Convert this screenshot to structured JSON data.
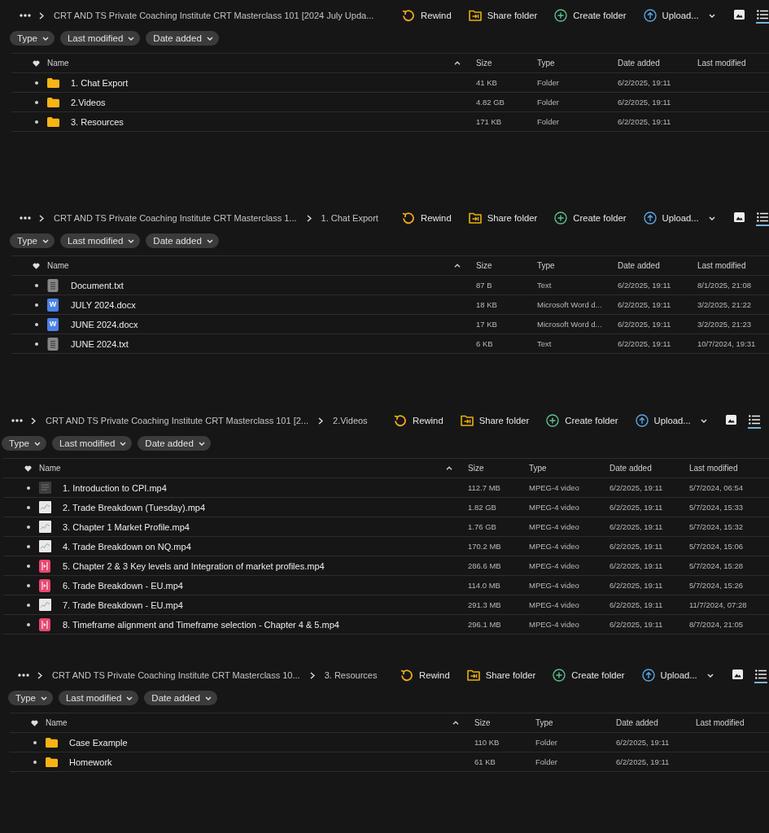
{
  "panels": [
    {
      "breadcrumb": [
        "CRT AND TS Private Coaching Institute CRT Masterclass 101 [2024 July Upda..."
      ],
      "actions": [
        {
          "kind": "rewind",
          "label": "Rewind"
        },
        {
          "kind": "share",
          "label": "Share folder"
        },
        {
          "kind": "create",
          "label": "Create folder"
        },
        {
          "kind": "upload",
          "label": "Upload..."
        }
      ],
      "views": [
        {
          "kind": "gallery",
          "selected": false
        },
        {
          "kind": "list",
          "selected": true
        }
      ],
      "filters": [
        "Type",
        "Last modified",
        "Date added"
      ],
      "columns": [
        {
          "label": "Name",
          "sorted": true
        },
        {
          "label": "Size",
          "sorted": false
        },
        {
          "label": "Type",
          "sorted": false
        },
        {
          "label": "Date added",
          "sorted": false
        },
        {
          "label": "Last modified",
          "sorted": false
        }
      ],
      "rows": [
        {
          "kind": "folder",
          "name": "1. Chat Export",
          "size": "41 KB",
          "type": "Folder",
          "date_added": "6/2/2025, 19:11"
        },
        {
          "kind": "folder",
          "name": "2.Videos",
          "size": "4.82 GB",
          "type": "Folder",
          "date_added": "6/2/2025, 19:11"
        },
        {
          "kind": "folder",
          "name": "3. Resources",
          "size": "171 KB",
          "type": "Folder",
          "date_added": "6/2/2025, 19:11"
        }
      ]
    },
    {
      "breadcrumb": [
        "CRT AND TS Private Coaching Institute CRT Masterclass 1...",
        "1. Chat Export"
      ],
      "actions": [
        {
          "kind": "rewind",
          "label": "Rewind"
        },
        {
          "kind": "share",
          "label": "Share folder"
        },
        {
          "kind": "create",
          "label": "Create folder"
        },
        {
          "kind": "upload",
          "label": "Upload..."
        }
      ],
      "views": [
        {
          "kind": "gallery",
          "selected": false
        },
        {
          "kind": "list",
          "selected": true
        }
      ],
      "filters": [
        "Type",
        "Last modified",
        "Date added"
      ],
      "columns": [
        {
          "label": "Name",
          "sorted": true
        },
        {
          "label": "Size",
          "sorted": false
        },
        {
          "label": "Type",
          "sorted": false
        },
        {
          "label": "Date added",
          "sorted": false
        },
        {
          "label": "Last modified",
          "sorted": false
        }
      ],
      "rows": [
        {
          "kind": "text",
          "name": "Document.txt",
          "size": "87 B",
          "type": "Text",
          "date_added": "6/2/2025, 19:11",
          "last_modified": "8/1/2025, 21:08"
        },
        {
          "kind": "word",
          "icon_letter": "W",
          "name": "JULY 2024.docx",
          "size": "18 KB",
          "type": "Microsoft Word d...",
          "date_added": "6/2/2025, 19:11",
          "last_modified": "3/2/2025, 21:22"
        },
        {
          "kind": "word",
          "icon_letter": "W",
          "name": "JUNE 2024.docx",
          "size": "17 KB",
          "type": "Microsoft Word d...",
          "date_added": "6/2/2025, 19:11",
          "last_modified": "3/2/2025, 21:23"
        },
        {
          "kind": "text",
          "name": "JUNE 2024.txt",
          "size": "6 KB",
          "type": "Text",
          "date_added": "6/2/2025, 19:11",
          "last_modified": "10/7/2024, 19:31"
        }
      ]
    },
    {
      "breadcrumb": [
        "CRT AND TS Private Coaching Institute CRT Masterclass 101 [2...",
        "2.Videos"
      ],
      "actions": [
        {
          "kind": "rewind",
          "label": "Rewind"
        },
        {
          "kind": "share",
          "label": "Share folder"
        },
        {
          "kind": "create",
          "label": "Create folder"
        },
        {
          "kind": "upload",
          "label": "Upload..."
        }
      ],
      "views": [
        {
          "kind": "gallery",
          "selected": false
        },
        {
          "kind": "list",
          "selected": true
        }
      ],
      "filters": [
        "Type",
        "Last modified",
        "Date added"
      ],
      "columns": [
        {
          "label": "Name",
          "sorted": true
        },
        {
          "label": "Size",
          "sorted": false
        },
        {
          "label": "Type",
          "sorted": false
        },
        {
          "label": "Date added",
          "sorted": false
        },
        {
          "label": "Last modified",
          "sorted": false
        }
      ],
      "rows": [
        {
          "kind": "darkthumb",
          "name": "1. Introduction to CPI.mp4",
          "size": "112.7 MB",
          "type": "MPEG-4 video",
          "date_added": "6/2/2025, 19:11",
          "last_modified": "5/7/2024, 06:54"
        },
        {
          "kind": "thumbnail",
          "name": "2. Trade Breakdown (Tuesday).mp4",
          "size": "1.82 GB",
          "type": "MPEG-4 video",
          "date_added": "6/2/2025, 19:11",
          "last_modified": "5/7/2024, 15:33"
        },
        {
          "kind": "thumbnail",
          "name": "3. Chapter 1 Market Profile.mp4",
          "size": "1.76 GB",
          "type": "MPEG-4 video",
          "date_added": "6/2/2025, 19:11",
          "last_modified": "5/7/2024, 15:32"
        },
        {
          "kind": "thumbnail",
          "name": "4. Trade Breakdown on NQ.mp4",
          "size": "170.2 MB",
          "type": "MPEG-4 video",
          "date_added": "6/2/2025, 19:11",
          "last_modified": "5/7/2024, 15:06"
        },
        {
          "kind": "video",
          "name": "5. Chapter 2 & 3 Key levels and Integration of market profiles.mp4",
          "size": "286.6 MB",
          "type": "MPEG-4 video",
          "date_added": "6/2/2025, 19:11",
          "last_modified": "5/7/2024, 15:28"
        },
        {
          "kind": "video",
          "name": "6. Trade Breakdown - EU.mp4",
          "size": "114.0 MB",
          "type": "MPEG-4 video",
          "date_added": "6/2/2025, 19:11",
          "last_modified": "5/7/2024, 15:26"
        },
        {
          "kind": "thumbnail",
          "name": "7. Trade Breakdown - EU.mp4",
          "size": "291.3 MB",
          "type": "MPEG-4 video",
          "date_added": "6/2/2025, 19:11",
          "last_modified": "11/7/2024, 07:28"
        },
        {
          "kind": "video",
          "name": "8. Timeframe alignment and Timeframe selection - Chapter 4 & 5.mp4",
          "size": "296.1 MB",
          "type": "MPEG-4 video",
          "date_added": "6/2/2025, 19:11",
          "last_modified": "8/7/2024, 21:05"
        }
      ]
    },
    {
      "breadcrumb": [
        "CRT AND TS Private Coaching Institute CRT Masterclass 10...",
        "3. Resources"
      ],
      "actions": [
        {
          "kind": "rewind",
          "label": "Rewind"
        },
        {
          "kind": "share",
          "label": "Share folder"
        },
        {
          "kind": "create",
          "label": "Create folder"
        },
        {
          "kind": "upload",
          "label": "Upload..."
        }
      ],
      "views": [
        {
          "kind": "gallery",
          "selected": false
        },
        {
          "kind": "list",
          "selected": true
        }
      ],
      "filters": [
        "Type",
        "Last modified",
        "Date added"
      ],
      "columns": [
        {
          "label": "Name",
          "sorted": true
        },
        {
          "label": "Size",
          "sorted": false
        },
        {
          "label": "Type",
          "sorted": false
        },
        {
          "label": "Date added",
          "sorted": false
        },
        {
          "label": "Last modified",
          "sorted": false
        }
      ],
      "rows": [
        {
          "kind": "folder",
          "name": "Case Example",
          "size": "110 KB",
          "type": "Folder",
          "date_added": "6/2/2025, 19:11"
        },
        {
          "kind": "folder",
          "name": "Homework",
          "size": "61 KB",
          "type": "Folder",
          "date_added": "6/2/2025, 19:11"
        }
      ]
    }
  ]
}
